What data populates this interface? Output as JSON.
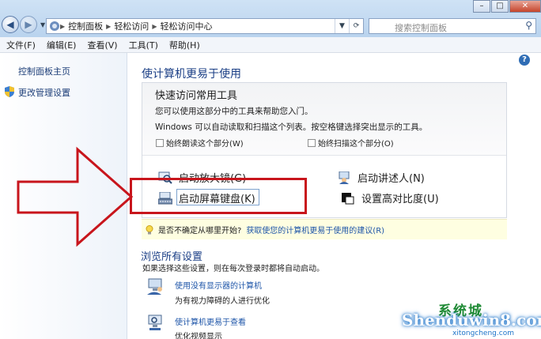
{
  "window": {
    "minimize": "–",
    "maximize": "□",
    "close": "✕",
    "accent": "#1b3f86",
    "link_color": "#1e55a8",
    "highlight_color": "#c8151c"
  },
  "address": {
    "crumbs": [
      "控制面板",
      "轻松访问",
      "轻松访问中心"
    ],
    "search_placeholder": "搜索控制面板"
  },
  "menu": [
    "文件(F)",
    "编辑(E)",
    "查看(V)",
    "工具(T)",
    "帮助(H)"
  ],
  "sidebar": {
    "home": "控制面板主页",
    "admin": "更改管理设置"
  },
  "main": {
    "heading": "使计算机更易于使用",
    "panel": {
      "title": "快速访问常用工具",
      "line1": "您可以使用这部分中的工具来帮助您入门。",
      "line2": "Windows 可以自动读取和扫描这个列表。按空格键选择突出显示的工具。",
      "check_read": "始终朗读这个部分(W)",
      "check_scan": "始终扫描这个部分(O)",
      "tools": {
        "magnifier": "启动放大镜(G)",
        "narrator": "启动讲述人(N)",
        "osk": "启动屏幕键盘(K)",
        "contrast": "设置高对比度(U)"
      }
    },
    "tip": {
      "question": "是否不确定从哪里开始?",
      "link": "获取使您的计算机更易于使用的建议(R)"
    },
    "browse": {
      "heading": "浏览所有设置",
      "subtitle": "如果选择这些设置，则在每次登录时都将自动启动。",
      "items": [
        {
          "link": "使用没有显示器的计算机",
          "desc": "为有视力障碍的人进行优化"
        },
        {
          "link": "使计算机更易于查看",
          "desc": "优化视频显示"
        }
      ]
    }
  },
  "watermark": {
    "top": "系统城",
    "main": "Shenduwin8.com",
    "sub": "xitongcheng.com"
  }
}
